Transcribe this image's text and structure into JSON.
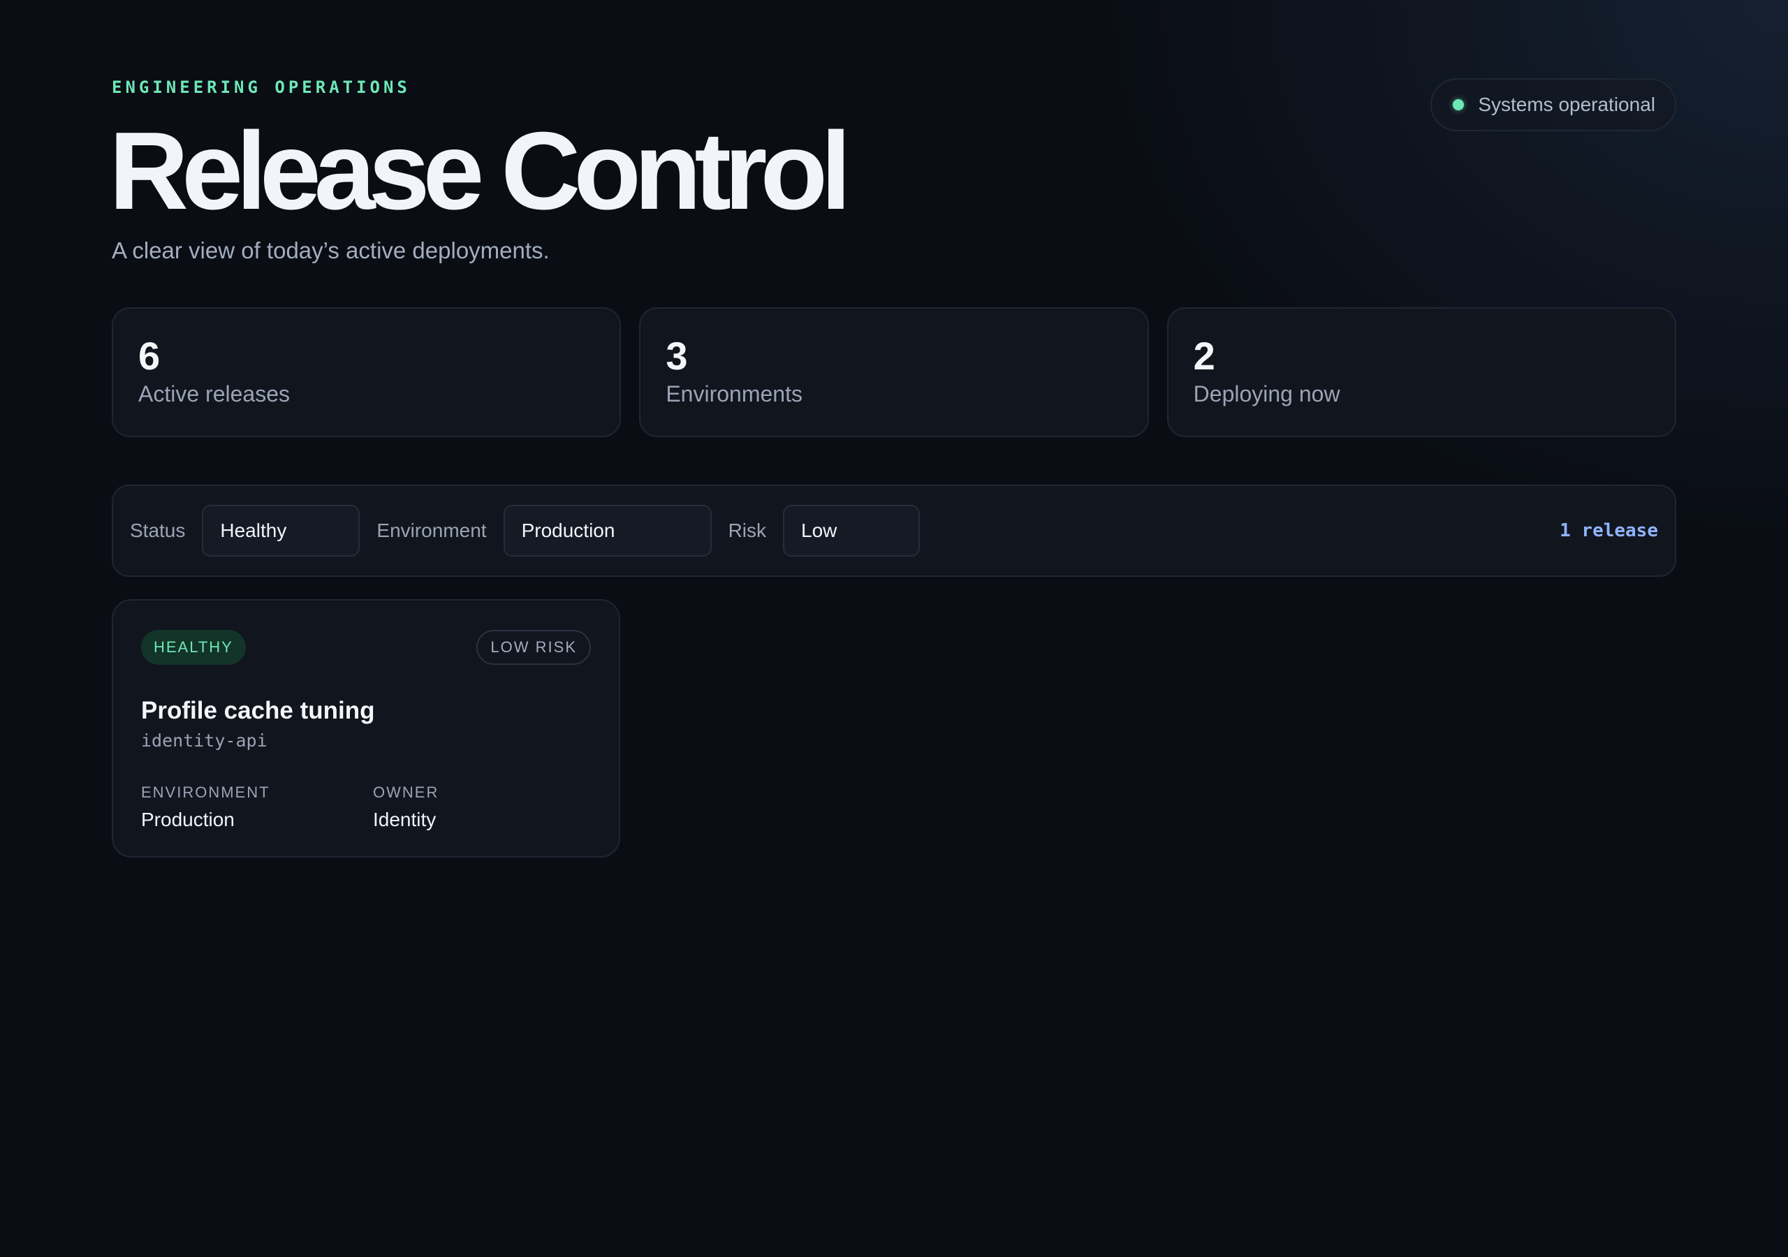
{
  "header": {
    "eyebrow": "ENGINEERING OPERATIONS",
    "title": "Release Control",
    "subtitle": "A clear view of today’s active deployments.",
    "status": {
      "label": "Systems operational",
      "color": "#6ee7b7"
    }
  },
  "stats": [
    {
      "value": "6",
      "label": "Active releases"
    },
    {
      "value": "3",
      "label": "Environments"
    },
    {
      "value": "2",
      "label": "Deploying now"
    }
  ],
  "filters": {
    "status": {
      "label": "Status",
      "value": "Healthy"
    },
    "environment": {
      "label": "Environment",
      "value": "Production"
    },
    "risk": {
      "label": "Risk",
      "value": "Low"
    },
    "result_count": "1 release"
  },
  "releases": [
    {
      "status_badge": "HEALTHY",
      "risk_badge": "LOW RISK",
      "name": "Profile cache tuning",
      "service": "identity-api",
      "environment_label": "ENVIRONMENT",
      "environment": "Production",
      "owner_label": "OWNER",
      "owner": "Identity"
    }
  ],
  "colors": {
    "accent_green": "#6ee7b7",
    "accent_blue": "#8fb4ff",
    "background": "#0a0d14",
    "card": "#11151e"
  }
}
